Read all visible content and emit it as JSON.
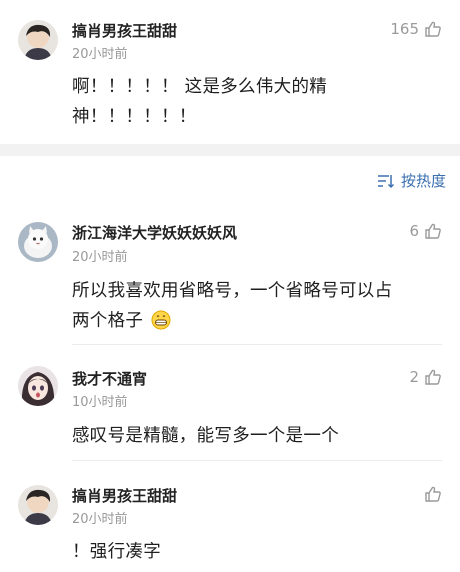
{
  "comments": [
    {
      "user": "搞肖男孩王甜甜",
      "time": "20小时前",
      "likes": "165",
      "lines": [
        "啊！！！！！ 这是多么伟大的精",
        "神！！！！！！"
      ]
    },
    {
      "user": "浙江海洋大学妖妖妖妖风",
      "time": "20小时前",
      "likes": "6",
      "lines": [
        "所以我喜欢用省略号，一个省略号可以占",
        "两个格子"
      ]
    },
    {
      "user": "我才不通宵",
      "time": "10小时前",
      "likes": "2",
      "lines": [
        "感叹号是精髓，能写多一个是一个"
      ]
    },
    {
      "user": "搞肖男孩王甜甜",
      "time": "20小时前",
      "likes": "",
      "lines": [
        "！强行凑字"
      ]
    }
  ],
  "sort": {
    "label": "按热度"
  },
  "icons": {
    "like": "thumbs-up-icon",
    "sort": "sort-icon",
    "emoji": "grin-emoji-icon"
  },
  "colors": {
    "accent": "#3a6fb0",
    "muted": "#999999",
    "text": "#1f1f1f"
  }
}
